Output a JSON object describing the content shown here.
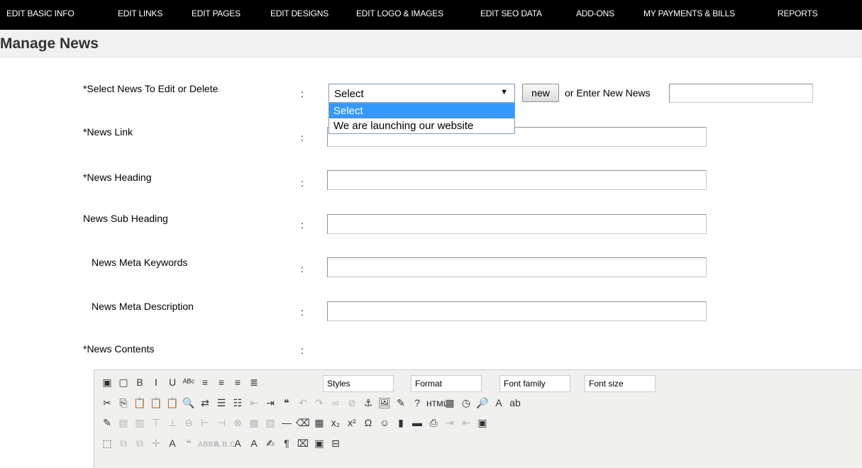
{
  "nav": {
    "items": [
      {
        "label": "EDIT BASIC INFO"
      },
      {
        "label": "EDIT LINKS"
      },
      {
        "label": "EDIT PAGES"
      },
      {
        "label": "EDIT DESIGNS"
      },
      {
        "label": "EDIT LOGO & IMAGES"
      },
      {
        "label": "EDIT SEO DATA"
      },
      {
        "label": "ADD-ONS"
      },
      {
        "label": "MY PAYMENTS & BILLS"
      },
      {
        "label": "REPORTS"
      }
    ]
  },
  "page": {
    "title": "Manage News"
  },
  "form": {
    "select_news": {
      "label": "*Select News To Edit or Delete",
      "colon": ":",
      "selected": "Select",
      "arrow": "▼",
      "options": [
        "Select",
        "We are launching our website"
      ]
    },
    "new_button": "new",
    "or_label": "or Enter New News",
    "new_news_value": "",
    "fields": [
      {
        "label": "*News Link",
        "colon": ":",
        "value": ""
      },
      {
        "label": "*News Heading",
        "colon": ":",
        "value": ""
      },
      {
        "label": "News Sub Heading",
        "colon": ":",
        "value": ""
      },
      {
        "label": "News Meta Keywords",
        "colon": ":",
        "value": ""
      },
      {
        "label": "News Meta Description",
        "colon": ":",
        "value": ""
      }
    ],
    "contents": {
      "label": "*News Contents",
      "colon": ":"
    }
  },
  "editor": {
    "row1": {
      "icons": [
        "save-icon",
        "new-document-icon",
        "bold-icon",
        "italic-icon",
        "underline-icon",
        "strikethrough-icon",
        "align-left-icon",
        "align-center-icon",
        "align-right-icon",
        "align-justify-icon"
      ],
      "glyphs": [
        "▣",
        "▢",
        "B",
        "I",
        "U",
        "ᴬᴮᶜ",
        "≡",
        "≡",
        "≡",
        "≣"
      ],
      "selects": [
        "Styles",
        "Format",
        "Font family",
        "Font size"
      ]
    },
    "row2": {
      "icons": [
        "cut-icon",
        "copy-icon",
        "paste-icon",
        "paste-text-icon",
        "paste-word-icon",
        "find-icon",
        "replace-icon",
        "bullet-list-icon",
        "numbered-list-icon",
        "outdent-icon",
        "indent-icon",
        "blockquote-icon",
        "undo-icon",
        "redo-icon",
        "link-icon",
        "unlink-icon",
        "anchor-icon",
        "image-icon",
        "cleanup-icon",
        "help-icon",
        "html-icon",
        "insert-date-icon",
        "insert-time-icon",
        "preview-icon",
        "text-color-icon",
        "background-color-icon"
      ],
      "glyphs": [
        "✂",
        "⎘",
        "📋",
        "📋",
        "📋",
        "🔍",
        "⇄",
        "☰",
        "☷",
        "⇤",
        "⇥",
        "❝",
        "↶",
        "↷",
        "∞",
        "⊘",
        "⚓",
        "🖼",
        "✎",
        "?",
        "ʜᴛᴍʟ",
        "▦",
        "◷",
        "🔎",
        "A",
        "ab"
      ]
    },
    "row3": {
      "icons": [
        "table-edit-icon",
        "row-props-icon",
        "cell-props-icon",
        "insert-row-before-icon",
        "insert-row-after-icon",
        "delete-row-icon",
        "insert-col-before-icon",
        "insert-col-after-icon",
        "delete-col-icon",
        "split-cells-icon",
        "merge-cells-icon",
        "horizontal-rule-icon",
        "remove-format-icon",
        "visual-aid-icon",
        "subscript-icon",
        "superscript-icon",
        "special-char-icon",
        "emoticon-icon",
        "media-icon",
        "advanced-hr-icon",
        "print-icon",
        "ltr-icon",
        "rtl-icon",
        "fullscreen-icon"
      ],
      "glyphs": [
        "✎",
        "▤",
        "▥",
        "⊤",
        "⊥",
        "⊖",
        "⊢",
        "⊣",
        "⊗",
        "▦",
        "▧",
        "—",
        "⌫",
        "▦",
        "x₂",
        "x²",
        "Ω",
        "☺",
        "▮",
        "▬",
        "⎙",
        "⇥",
        "⇤",
        "▣"
      ]
    },
    "row4": {
      "icons": [
        "insert-layer-icon",
        "move-forward-icon",
        "move-backward-icon",
        "absolute-position-icon",
        "styles-props-icon",
        "cite-icon",
        "abbreviation-icon",
        "acronym-icon",
        "deletion-icon",
        "insertion-icon",
        "attributes-icon",
        "visual-chars-icon",
        "non-breaking-icon",
        "template-icon",
        "page-break-icon"
      ],
      "glyphs": [
        "⬚",
        "⧉",
        "⧉",
        "✛",
        "A",
        "❝",
        "ᴀʙʙʀ",
        "ᴀ.ʙ.ᴄ",
        "A",
        "A",
        "✍",
        "¶",
        "⌧",
        "▣",
        "⊟"
      ]
    }
  }
}
